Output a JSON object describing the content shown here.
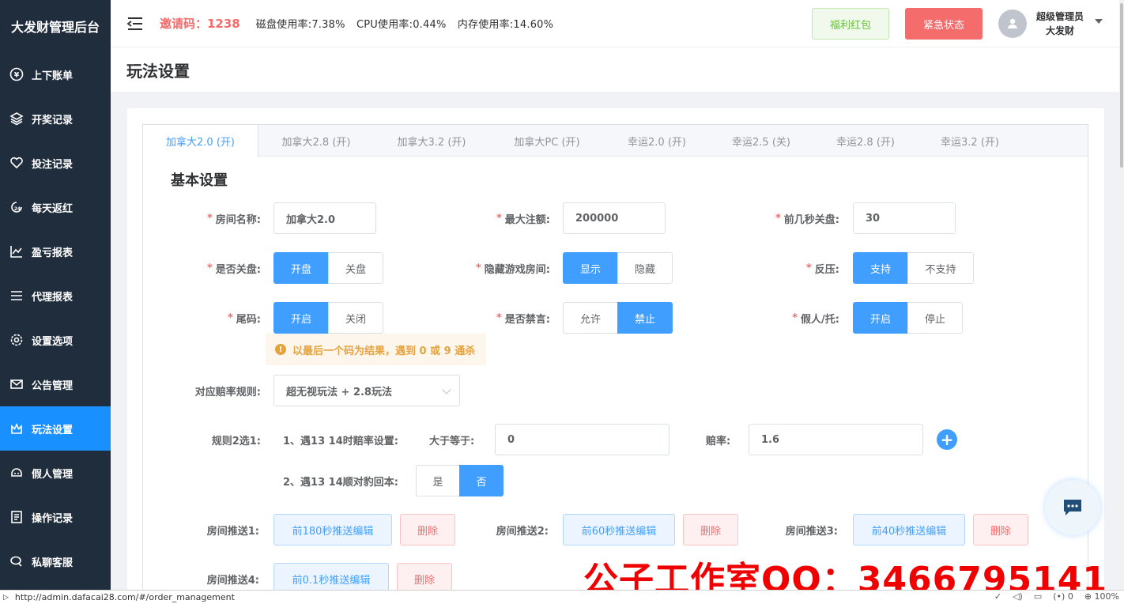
{
  "app": {
    "brand": "大发财管理后台"
  },
  "sidebar": {
    "items": [
      {
        "label": "上下账单",
        "icon": "yen-circle-icon"
      },
      {
        "label": "开奖记录",
        "icon": "layers-icon"
      },
      {
        "label": "投注记录",
        "icon": "heart-hand-icon"
      },
      {
        "label": "每天返红",
        "icon": "clock-24-icon"
      },
      {
        "label": "盈亏报表",
        "icon": "line-chart-icon"
      },
      {
        "label": "代理报表",
        "icon": "list-icon"
      },
      {
        "label": "设置选项",
        "icon": "gear-icon"
      },
      {
        "label": "公告管理",
        "icon": "mail-icon"
      },
      {
        "label": "玩法设置",
        "icon": "crown-icon",
        "active": true
      },
      {
        "label": "假人管理",
        "icon": "robot-icon"
      },
      {
        "label": "操作记录",
        "icon": "document-icon"
      },
      {
        "label": "私聊客服",
        "icon": "chat-icon"
      }
    ]
  },
  "header": {
    "invite": "邀请码：1238",
    "disk": "磁盘使用率:7.38%",
    "cpu": "CPU使用率:0.44%",
    "mem": "内存使用率:14.60%",
    "welfare_btn": "福利红包",
    "emergency_btn": "紧急状态",
    "user_role": "超级管理员",
    "user_name": "大发财"
  },
  "page": {
    "title": "玩法设置"
  },
  "tabs": [
    {
      "label": "加拿大2.0 (开)",
      "active": true
    },
    {
      "label": "加拿大2.8 (开)"
    },
    {
      "label": "加拿大3.2 (开)"
    },
    {
      "label": "加拿大PC (开)"
    },
    {
      "label": "幸运2.0 (开)"
    },
    {
      "label": "幸运2.5 (关)"
    },
    {
      "label": "幸运2.8 (开)"
    },
    {
      "label": "幸运3.2 (开)"
    }
  ],
  "form": {
    "section_title": "基本设置",
    "room_name_label": "房间名称:",
    "room_name_value": "加拿大2.0",
    "max_bet_label": "最大注额:",
    "max_bet_value": "200000",
    "close_sec_label": "前几秒关盘:",
    "close_sec_value": "30",
    "is_closed_label": "是否关盘:",
    "is_closed_opts": [
      "开盘",
      "关盘"
    ],
    "hide_room_label": "隐藏游戏房间:",
    "hide_room_opts": [
      "显示",
      "隐藏"
    ],
    "counter_label": "反压:",
    "counter_opts": [
      "支持",
      "不支持"
    ],
    "tail_label": "尾码:",
    "tail_opts": [
      "开启",
      "关闭"
    ],
    "mute_label": "是否禁言:",
    "mute_opts": [
      "允许",
      "禁止"
    ],
    "fake_label": "假人/托:",
    "fake_opts": [
      "开启",
      "停止"
    ],
    "tail_notice": "以最后一个码为结果，遇到 0 或 9 通杀",
    "odds_rule_label": "对应赔率规则:",
    "odds_rule_value": "超无视玩法 + 2.8玩法",
    "rule2_label": "规则2选1:",
    "rule2_item1": "1、遇13 14时赔率设置:",
    "gte_label": "大于等于:",
    "gte_value": "0",
    "odds_label": "赔率:",
    "odds_value": "1.6",
    "rule2_item2": "2、遇13 14顺对豹回本:",
    "refund_opts": [
      "是",
      "否"
    ],
    "push1_label": "房间推送1:",
    "push1_btn": "前180秒推送编辑",
    "push2_label": "房间推送2:",
    "push2_btn": "前60秒推送编辑",
    "push3_label": "房间推送3:",
    "push3_btn": "前40秒推送编辑",
    "push4_label": "房间推送4:",
    "push4_btn": "前0.1秒推送编辑",
    "delete_btn": "删除"
  },
  "watermark": "公子工作室QQ：3466795141",
  "statusbar": {
    "url": "http://admin.dafacai28.com/#/order_management",
    "zoom": "100%",
    "count": "0"
  }
}
